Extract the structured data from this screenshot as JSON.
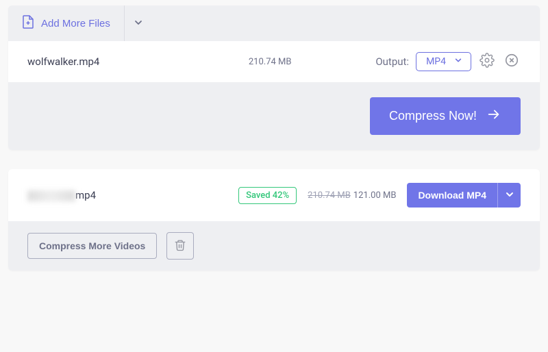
{
  "card1": {
    "add_more_label": "Add More Files",
    "file": {
      "name": "wolfwalker.mp4",
      "size": "210.74 MB"
    },
    "output_label": "Output:",
    "output_format": "MP4",
    "compress_label": "Compress Now!"
  },
  "card2": {
    "result": {
      "extension": "mp4",
      "saved_badge": "Saved 42%",
      "old_size": "210.74 MB",
      "new_size": "121.00 MB",
      "download_label": "Download MP4"
    },
    "compress_more_label": "Compress More Videos"
  },
  "colors": {
    "accent": "#7075e8",
    "success": "#33c77a",
    "muted": "#6e7189"
  }
}
